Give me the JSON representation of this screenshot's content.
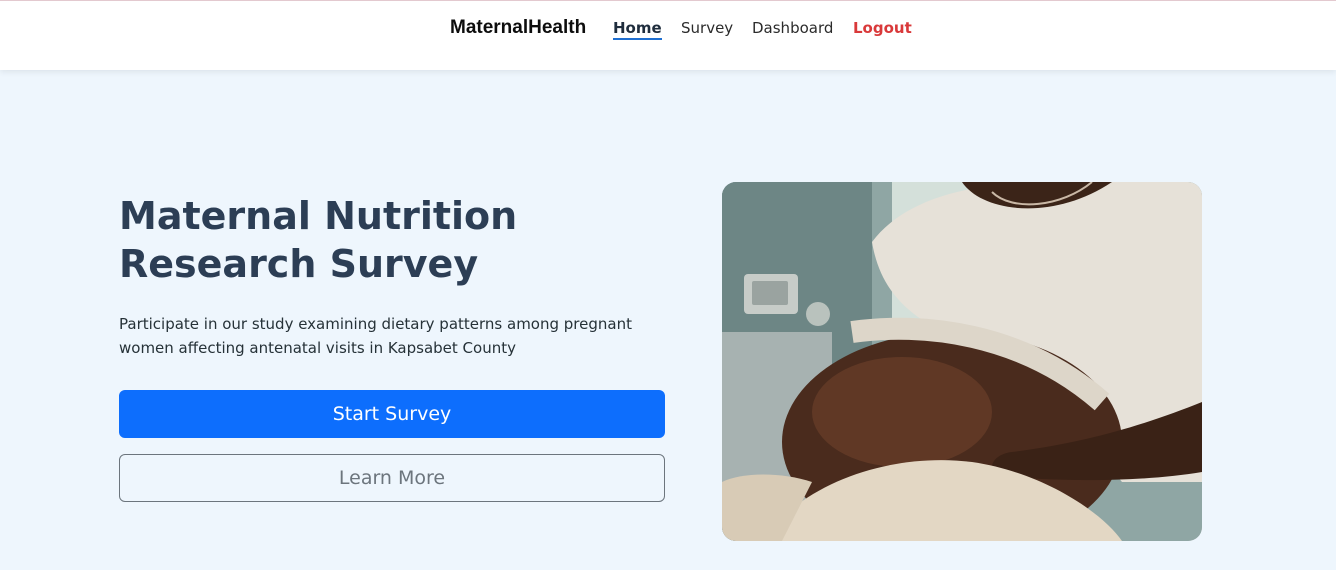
{
  "nav": {
    "brand": "MaternalHealth",
    "links": [
      {
        "label": "Home"
      },
      {
        "label": "Survey"
      },
      {
        "label": "Dashboard"
      },
      {
        "label": "Logout"
      }
    ]
  },
  "hero": {
    "title": "Maternal Nutrition Research Survey",
    "description": "Participate in our study examining dietary patterns among pregnant women affecting antenatal visits in Kapsabet County",
    "primary_button": "Start Survey",
    "secondary_button": "Learn More"
  },
  "colors": {
    "primary": "#0d6efd",
    "logout": "#d9393a",
    "heading": "#2c3e55",
    "background": "#eef6fd"
  }
}
